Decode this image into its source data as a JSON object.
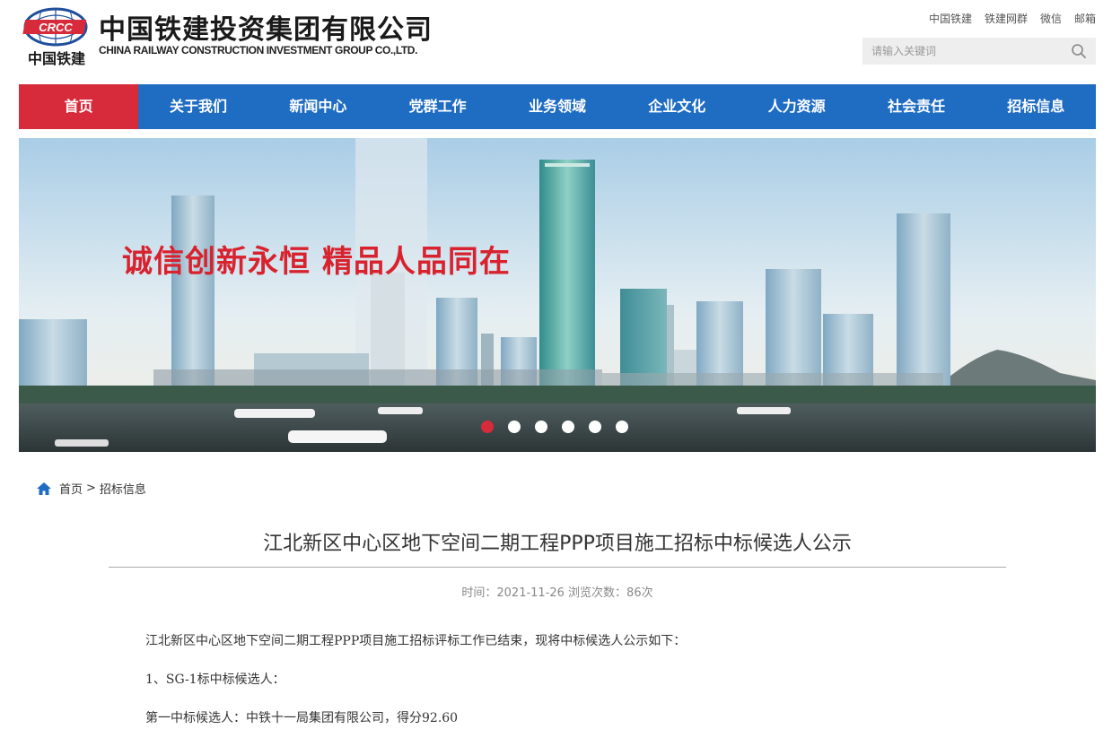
{
  "header": {
    "logo_text": "CRCC",
    "logo_cn": "中国铁建",
    "company_cn": "中国铁建投资集团有限公司",
    "company_en": "CHINA RAILWAY CONSTRUCTION INVESTMENT GROUP CO.,LTD.",
    "top_links": [
      "中国铁建",
      "铁建网群",
      "微信",
      "邮箱"
    ],
    "search_placeholder": "请输入关键词",
    "brand_color": "#d72b3b"
  },
  "nav": {
    "items": [
      "首页",
      "关于我们",
      "新闻中心",
      "党群工作",
      "业务领域",
      "企业文化",
      "人力资源",
      "社会责任",
      "招标信息"
    ],
    "active_index": 0,
    "bg_color": "#1f6cc3",
    "active_color": "#d72b3b"
  },
  "banner": {
    "slogan": "诚信创新永恒 精品人品同在",
    "slide_count": 6,
    "active_slide": 0
  },
  "breadcrumb": {
    "home": "首页",
    "separator": ">",
    "current": "招标信息"
  },
  "article": {
    "title": "江北新区中心区地下空间二期工程PPP项目施工招标中标候选人公示",
    "meta": "时间：2021-11-26 浏览次数：86次",
    "paragraphs": [
      "江北新区中心区地下空间二期工程PPP项目施工招标评标工作已结束，现将中标候选人公示如下：",
      "1、SG-1标中标候选人：",
      "第一中标候选人：中铁十一局集团有限公司，得分92.60"
    ]
  }
}
